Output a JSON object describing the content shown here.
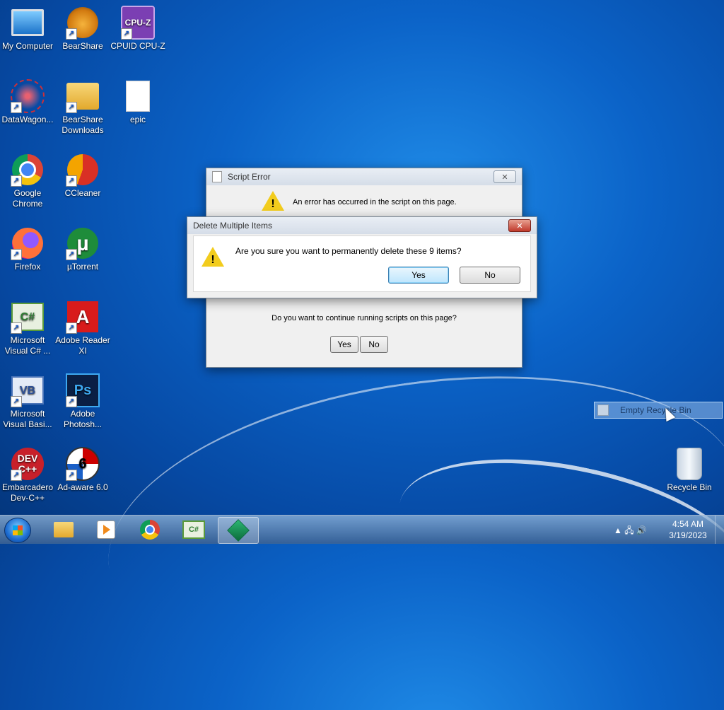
{
  "desktop": {
    "icons": [
      {
        "label": "My Computer"
      },
      {
        "label": "BearShare"
      },
      {
        "label": "CPUID CPU-Z",
        "glyph": "CPU-Z"
      },
      {
        "label": "DataWagon..."
      },
      {
        "label": "BearShare Downloads"
      },
      {
        "label": "epic"
      },
      {
        "label": "Google Chrome"
      },
      {
        "label": "CCleaner"
      },
      {
        "label": "Firefox"
      },
      {
        "label": "µTorrent",
        "glyph": "µ"
      },
      {
        "label": "Microsoft Visual C# ...",
        "glyph": "C#"
      },
      {
        "label": "Adobe Reader XI",
        "glyph": "A"
      },
      {
        "label": "Microsoft Visual Basi...",
        "glyph": "VB"
      },
      {
        "label": "Adobe Photosh...",
        "glyph": "Ps"
      },
      {
        "label": "Embarcadero Dev-C++",
        "glyph": "DEV C++"
      },
      {
        "label": "Ad-aware 6.0",
        "glyph": "6"
      },
      {
        "label": "Recycle Bin"
      }
    ],
    "shortcut_arrow": "↗"
  },
  "script_error": {
    "title": "Script Error",
    "close_glyph": "✕",
    "message": "An error has occurred in the script on this page.",
    "question": "Do you want to continue running scripts on this page?",
    "yes_label": "Yes",
    "no_label": "No"
  },
  "delete_dialog": {
    "title": "Delete Multiple Items",
    "close_glyph": "✕",
    "message": "Are you sure you want to permanently delete these 9 items?",
    "yes_label": "Yes",
    "no_label": "No",
    "warning_mark": "!"
  },
  "context_menu": {
    "item_label": "Empty Recycle Bin"
  },
  "taskbar": {
    "tray_icons": "▲  🖧  🔊",
    "time": "4:54 AM",
    "date": "3/19/2023",
    "csharp_glyph": "C#"
  }
}
